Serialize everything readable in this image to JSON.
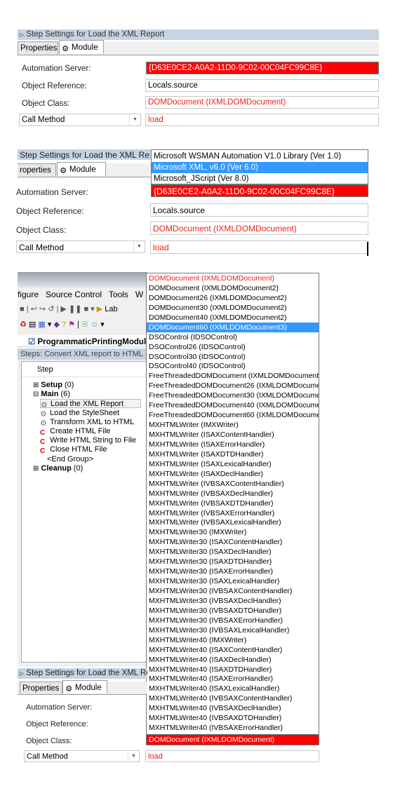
{
  "panel1": {
    "title": "Step Settings for Load the XML Report",
    "tabs": [
      "Properties",
      "Module"
    ],
    "automation_server_label": "Automation Server:",
    "automation_server_value": "{D63E0CE2-A0A2-11D0-9C02-00C04FC99C8E}",
    "object_reference_label": "Object Reference:",
    "object_reference_value": "Locals.source",
    "object_class_label": "Object Class:",
    "object_class_value": "DOMDocument (IXMLDOMDocument)",
    "call_method": "Call Method",
    "method_value": "load"
  },
  "panel2": {
    "title": "Step Settings for Load the XML Re",
    "tabs": [
      "roperties",
      "Module"
    ],
    "server_options": [
      "Microsoft WSMAN Automation V1.0 Library (Ver 1.0)",
      "Microsoft XML, v6.0 (Ver 6.0)",
      "Microsoft_JScript (Ver 8.0)"
    ],
    "selected_option_index": 1,
    "automation_server_label": "Automation Server:",
    "automation_server_value": "{D63E0CE2-A0A2-11D0-9C02-00C04FC99C8E}",
    "object_reference_label": "Object Reference:",
    "object_reference_value": "Locals.source",
    "object_class_label": "Object Class:",
    "object_class_value": "DOMDocument (IXMLDOMDocument)",
    "call_method": "Call Method",
    "method_value": "load"
  },
  "panel3": {
    "menu": [
      "figure",
      "Source Control",
      "Tools",
      "W"
    ],
    "toolbar_label": "Lab",
    "document_tab": "ProgrammaticPrintingModul",
    "steps_header": "Steps: Convert XML report to HTML",
    "column_header": "Step",
    "tree": [
      {
        "label": "Setup",
        "count": "(0)",
        "type": "group",
        "expander": "+"
      },
      {
        "label": "Main",
        "count": "(6)",
        "type": "group",
        "expander": "-"
      },
      {
        "label": "Load the XML Report",
        "type": "activex",
        "selected": true
      },
      {
        "label": "Load the StyleSheet",
        "type": "activex"
      },
      {
        "label": "Transform XML to HTML",
        "type": "activex"
      },
      {
        "label": "Create HTML File",
        "type": "c"
      },
      {
        "label": "Write HTML String to File",
        "type": "c"
      },
      {
        "label": "Close HTML File",
        "type": "c"
      },
      {
        "label": "<End Group>",
        "type": "end"
      },
      {
        "label": "Cleanup",
        "count": "(0)",
        "type": "group",
        "expander": "+"
      }
    ],
    "class_options": [
      "DOMDocument (IXMLDOMDocument)",
      "DOMDocument (IXMLDOMDocument2)",
      "DOMDocument26 (IXMLDOMDocument2)",
      "DOMDocument30 (IXMLDOMDocument2)",
      "DOMDocument40 (IXMLDOMDocument2)",
      "DOMDocument60 (IXMLDOMDocument3)",
      "DSOControl (IDSOControl)",
      "DSOControl26 (IDSOControl)",
      "DSOControl30 (IDSOControl)",
      "DSOControl40 (IDSOControl)",
      "FreeThreadedDOMDocument (IXMLDOMDocument2",
      "FreeThreadedDOMDocument26 (IXMLDOMDocume",
      "FreeThreadedDOMDocument30 (IXMLDOMDocume",
      "FreeThreadedDOMDocument40 (IXMLDOMDocume",
      "FreeThreadedDOMDocument60 (IXMLDOMDocume",
      "MXHTMLWriter (IMXWriter)",
      "MXHTMLWriter (ISAXContentHandler)",
      "MXHTMLWriter (ISAXErrorHandler)",
      "MXHTMLWriter (ISAXDTDHandler)",
      "MXHTMLWriter (ISAXLexicalHandler)",
      "MXHTMLWriter (ISAXDeclHandler)",
      "MXHTMLWriter (IVBSAXContentHandler)",
      "MXHTMLWriter (IVBSAXDeclHandler)",
      "MXHTMLWriter (IVBSAXDTDHandler)",
      "MXHTMLWriter (IVBSAXErrorHandler)",
      "MXHTMLWriter (IVBSAXLexicalHandler)",
      "MXHTMLWriter30 (IMXWriter)",
      "MXHTMLWriter30 (ISAXContentHandler)",
      "MXHTMLWriter30 (ISAXDeclHandler)",
      "MXHTMLWriter30 (ISAXDTDHandler)",
      "MXHTMLWriter30 (ISAXErrorHandler)",
      "MXHTMLWriter30 (ISAXLexicalHandler)",
      "MXHTMLWriter30 (IVBSAXContentHandler)",
      "MXHTMLWriter30 (IVBSAXDeclHandler)",
      "MXHTMLWriter30 (IVBSAXDTDHandler)",
      "MXHTMLWriter30 (IVBSAXErrorHandler)",
      "MXHTMLWriter30 (IVBSAXLexicalHandler)",
      "MXHTMLWriter40 (IMXWriter)",
      "MXHTMLWriter40 (ISAXContentHandler)",
      "MXHTMLWriter40 (ISAXDeclHandler)",
      "MXHTMLWriter40 (ISAXDTDHandler)",
      "MXHTMLWriter40 (ISAXErrorHandler)",
      "MXHTMLWriter40 (ISAXLexicalHandler)",
      "MXHTMLWriter40 (IVBSAXContentHandler)",
      "MXHTMLWriter40 (IVBSAXDeclHandler)",
      "MXHTMLWriter40 (IVBSAXDTDHandler)",
      "MXHTMLWriter40 (IVBSAXErrorHandler)"
    ],
    "selected_class_index": 5,
    "current_class_index": 0,
    "settings_title": "Step Settings for Load the XML Re",
    "tabs": [
      "Properties",
      "Module"
    ],
    "automation_server_label": "Automation Server:",
    "object_reference_label": "Object Reference:",
    "object_class_label": "Object Class:",
    "object_class_value": "DOMDocument (IXMLDOMDocument)",
    "call_method": "Call Method",
    "method_value": "load"
  },
  "colors": {
    "error_bg": "#ff0000",
    "invalid_text": "#f02020",
    "selection": "#3399ff",
    "titlebar": "#c5d3e2"
  }
}
